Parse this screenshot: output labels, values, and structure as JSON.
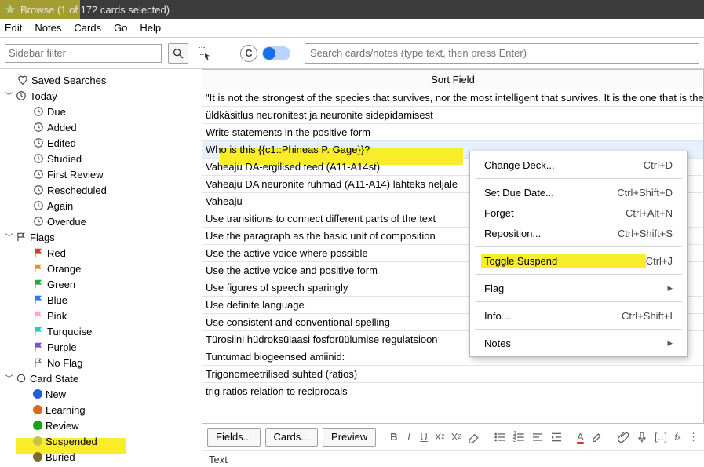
{
  "titlebar": {
    "text": "Browse (1 of 172 cards selected)"
  },
  "menubar": {
    "items": [
      "Edit",
      "Notes",
      "Cards",
      "Go",
      "Help"
    ]
  },
  "search": {
    "sidebar_placeholder": "Sidebar filter",
    "toggle_letter": "C",
    "main_placeholder": "Search cards/notes (type text, then press Enter)"
  },
  "sidebar": {
    "saved_searches": "Saved Searches",
    "today": {
      "label": "Today",
      "items": [
        "Due",
        "Added",
        "Edited",
        "Studied",
        "First Review",
        "Rescheduled",
        "Again",
        "Overdue"
      ]
    },
    "flags": {
      "label": "Flags",
      "items": [
        {
          "label": "Red",
          "color": "#d63b2f"
        },
        {
          "label": "Orange",
          "color": "#e8902a"
        },
        {
          "label": "Green",
          "color": "#2aa648"
        },
        {
          "label": "Blue",
          "color": "#2a7ee8"
        },
        {
          "label": "Pink",
          "color": "#ffa0d9"
        },
        {
          "label": "Turquoise",
          "color": "#2ac9c3"
        },
        {
          "label": "Purple",
          "color": "#7b4fd6"
        },
        {
          "label": "No Flag",
          "color": "none"
        }
      ]
    },
    "card_state": {
      "label": "Card State",
      "items": [
        {
          "label": "New",
          "color": "#1f5fd6"
        },
        {
          "label": "Learning",
          "color": "#d66a1f"
        },
        {
          "label": "Review",
          "color": "#16a316"
        },
        {
          "label": "Suspended",
          "color": "#c9c24a"
        },
        {
          "label": "Buried",
          "color": "#7a6b2a"
        }
      ]
    }
  },
  "grid": {
    "header": "Sort Field",
    "rows": [
      "\"It is not the strongest of the species that survives, nor the most intelligent that survives. It is the one that is the m",
      "üldkäsitlus neuronitest ja neuronite sidepidamisest",
      "Write statements in the positive form",
      "Who is this {{c1::Phineas P. Gage}}?",
      "Vaheaju DA-ergilised teed (A11-A14st)",
      "Vaheaju DA neuronite rühmad (A11-A14) lähteks neljale",
      "Vaheaju",
      "Use transitions to connect different parts of the text",
      "Use the paragraph as the basic unit of composition",
      "Use the active voice where possible",
      "Use the active voice and positive form",
      "Use figures of speech sparingly",
      "Use definite language",
      "Use consistent and conventional spelling",
      "Türosiini hüdroksülaasi fosforüülumise regulatsioon",
      "Tuntumad biogeensed amiinid:",
      "Trigonomeetrilised suhted (ratios)",
      "trig ratios relation to reciprocals"
    ],
    "selected_index": 3
  },
  "editor": {
    "buttons": {
      "fields": "Fields...",
      "cards": "Cards...",
      "preview": "Preview"
    },
    "field_label": "Text"
  },
  "context_menu": [
    {
      "label": "Change Deck...",
      "shortcut": "Ctrl+D"
    },
    {
      "sep": true
    },
    {
      "label": "Set Due Date...",
      "shortcut": "Ctrl+Shift+D"
    },
    {
      "label": "Forget",
      "shortcut": "Ctrl+Alt+N"
    },
    {
      "label": "Reposition...",
      "shortcut": "Ctrl+Shift+S"
    },
    {
      "sep": true
    },
    {
      "label": "Toggle Suspend",
      "shortcut": "Ctrl+J",
      "highlight": true
    },
    {
      "sep": true
    },
    {
      "label": "Flag",
      "submenu": true
    },
    {
      "sep": true
    },
    {
      "label": "Info...",
      "shortcut": "Ctrl+Shift+I"
    },
    {
      "sep": true
    },
    {
      "label": "Notes",
      "submenu": true
    }
  ]
}
